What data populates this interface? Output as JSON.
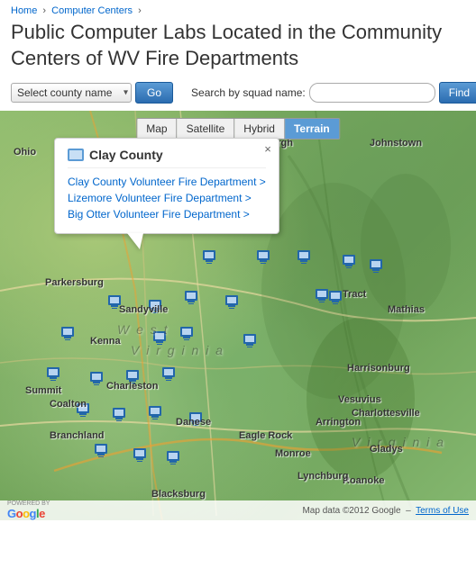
{
  "breadcrumb": {
    "home": "Home",
    "separator1": "›",
    "parent": "Computer Centers",
    "separator2": "›"
  },
  "page": {
    "title": "Public Computer Labs Located in the Community Centers of WV Fire Departments"
  },
  "controls": {
    "county_select_placeholder": "Select county name",
    "go_button": "Go",
    "search_label": "Search by squad name:",
    "search_placeholder": "",
    "find_button": "Find"
  },
  "map": {
    "type_buttons": [
      "Map",
      "Satellite",
      "Hybrid",
      "Terrain"
    ],
    "active_button": "Terrain",
    "footer_text": "Map data ©2012 Google",
    "terms_text": "Terms of Use",
    "powered_by": "POWERED BY"
  },
  "popup": {
    "title": "Clay County",
    "links": [
      "Clay County Volunteer Fire Department >",
      "Lizemore Volunteer Fire Department >",
      "Big Otter Volunteer Fire Department >"
    ],
    "close": "×"
  },
  "map_labels": {
    "ohio": "Ohio",
    "pittsburgh": "Pittsburgh",
    "johnstown": "Johnstown",
    "parkersburg": "Parkersburg",
    "west_virginia": "West Virginia",
    "harrisonburg": "Harrisonburg",
    "charlottesville": "Charlottesville",
    "virginia": "Virginia",
    "roanoke": "Roanoke",
    "lynchburg": "Lynchburg",
    "blacksburg": "Blacksburg",
    "charleston": "Charleston",
    "danese": "Danese",
    "sandyville": "Sandyville",
    "kenna": "Kenna",
    "summit": "Summit",
    "coalton": "Coalton",
    "branchland": "Branchland",
    "eagle_rock": "Eagle Rock",
    "monroe": "Monroe",
    "arrington": "Arrington",
    "mathias": "Mathias",
    "tract": "Tract",
    "vesuvius": "Vesuvius",
    "gladys": "Gladys"
  }
}
